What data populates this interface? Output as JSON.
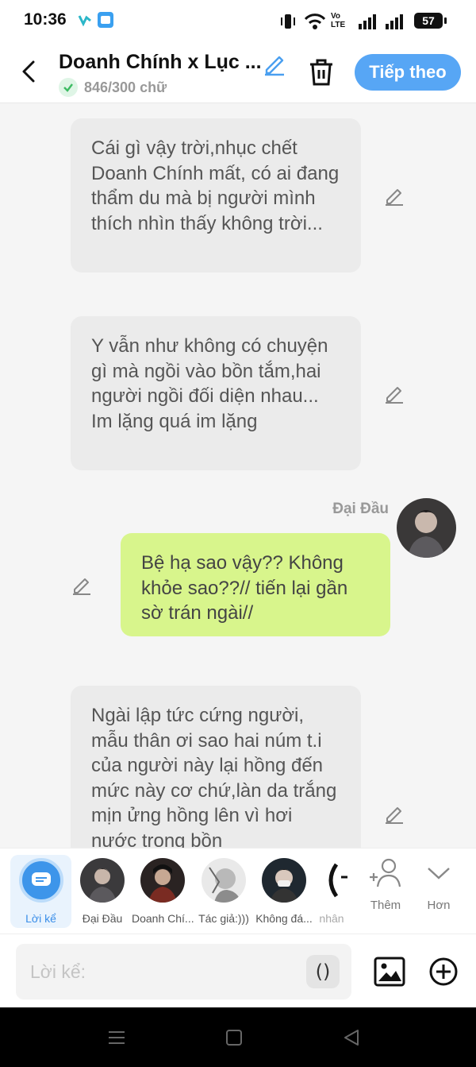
{
  "status": {
    "time": "10:36",
    "battery": "57",
    "network_label": "Vo LTE"
  },
  "header": {
    "title": "Doanh Chính x Lục ...",
    "word_count": "846/300 chữ",
    "next_label": "Tiếp theo"
  },
  "messages": [
    {
      "type": "narration",
      "text": "Cái gì vậy trời,nhục chết Doanh Chính mất, có ai đang thẩm du mà bị người mình thích nhìn thấy không trời..."
    },
    {
      "type": "narration",
      "text": "Y vẫn như không có chuyện gì mà ngồi vào bồn tắm,hai người ngồi đối diện nhau... Im lặng quá im lặng"
    },
    {
      "type": "character",
      "speaker": "Đại Đầu",
      "text": "Bệ hạ sao vậy?? Không khỏe sao??// tiến lại gần sờ trán ngài//"
    },
    {
      "type": "narration",
      "text": "Ngài lập tức cứng người, mẫu thân ơi sao hai núm t.i của người này lại hồng đến mức này cơ chứ,làn da trắng mịn ửng hồng lên vì hơi nước trong bồn"
    }
  ],
  "characters": [
    {
      "label": "Lời kể",
      "selected": true
    },
    {
      "label": "Đại Đầu"
    },
    {
      "label": "Doanh Chí..."
    },
    {
      "label": "Tác giả:)))"
    },
    {
      "label": "Không đá..."
    },
    {
      "label": "nhân"
    }
  ],
  "tools": {
    "more_label": "Thêm",
    "expand_label": "Hơn"
  },
  "input": {
    "placeholder": "Lời kể:",
    "paren": "()"
  },
  "colors": {
    "accent": "#57a6f5",
    "my_bubble": "#d8f58c",
    "narration_bubble": "#ebebeb"
  }
}
